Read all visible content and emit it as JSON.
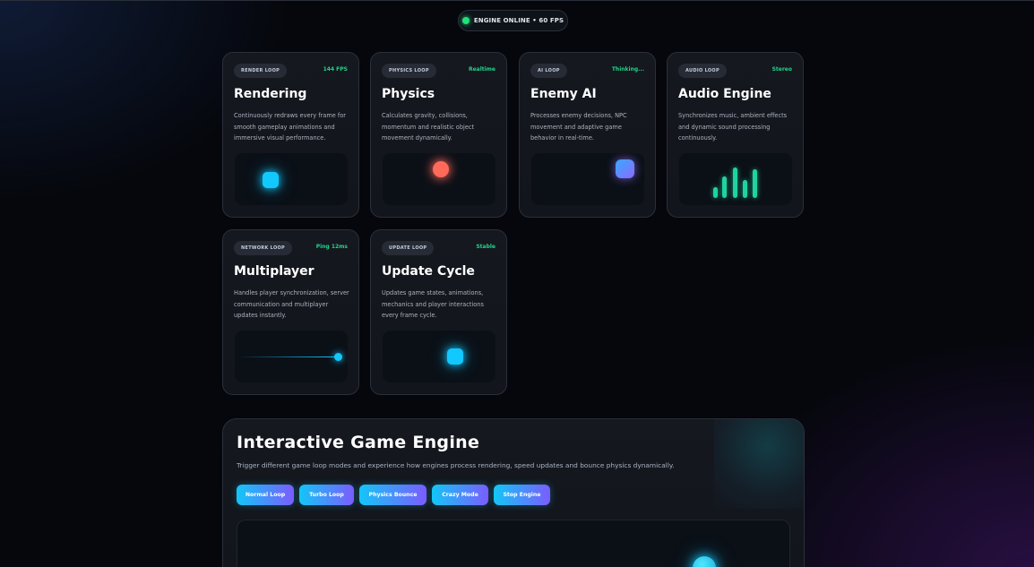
{
  "status": {
    "label": "ENGINE ONLINE • 60 FPS",
    "color": "#22e07a"
  },
  "cards": [
    {
      "tag": "RENDER LOOP",
      "metric": "144 FPS",
      "title": "Rendering",
      "description": "Continuously redraws every frame for smooth gameplay animations and immersive visual performance.",
      "preview": "glowing-square"
    },
    {
      "tag": "PHYSICS LOOP",
      "metric": "Realtime",
      "title": "Physics",
      "description": "Calculates gravity, collisions, momentum and realistic object movement dynamically.",
      "preview": "glowing-ball"
    },
    {
      "tag": "AI LOOP",
      "metric": "Thinking...",
      "title": "Enemy AI",
      "description": "Processes enemy decisions, NPC movement and adaptive game behavior in real-time.",
      "preview": "gradient-square"
    },
    {
      "tag": "AUDIO LOOP",
      "metric": "Stereo",
      "title": "Audio Engine",
      "description": "Synchronizes music, ambient effects and dynamic sound processing continuously.",
      "preview": "equalizer-bars"
    },
    {
      "tag": "NETWORK LOOP",
      "metric": "Ping 12ms",
      "title": "Multiplayer",
      "description": "Handles player synchronization, server communication and multiplayer updates instantly.",
      "preview": "network-line"
    },
    {
      "tag": "UPDATE LOOP",
      "metric": "Stable",
      "title": "Update Cycle",
      "description": "Updates game states, animations, mechanics and player interactions every frame cycle.",
      "preview": "glowing-square"
    }
  ],
  "engine": {
    "title": "Interactive Game Engine",
    "subtitle": "Trigger different game loop modes and experience how engines process rendering, speed updates and bounce physics dynamically.",
    "buttons": [
      "Normal Loop",
      "Turbo Loop",
      "Physics Bounce",
      "Crazy Mode",
      "Stop Engine"
    ]
  },
  "colors": {
    "accent_cyan": "#11c8ff",
    "accent_violet": "#7b5cff",
    "metric_green": "#22d38a",
    "eq_teal": "#1fd3a1",
    "ball_red": "#ff6a5b"
  }
}
